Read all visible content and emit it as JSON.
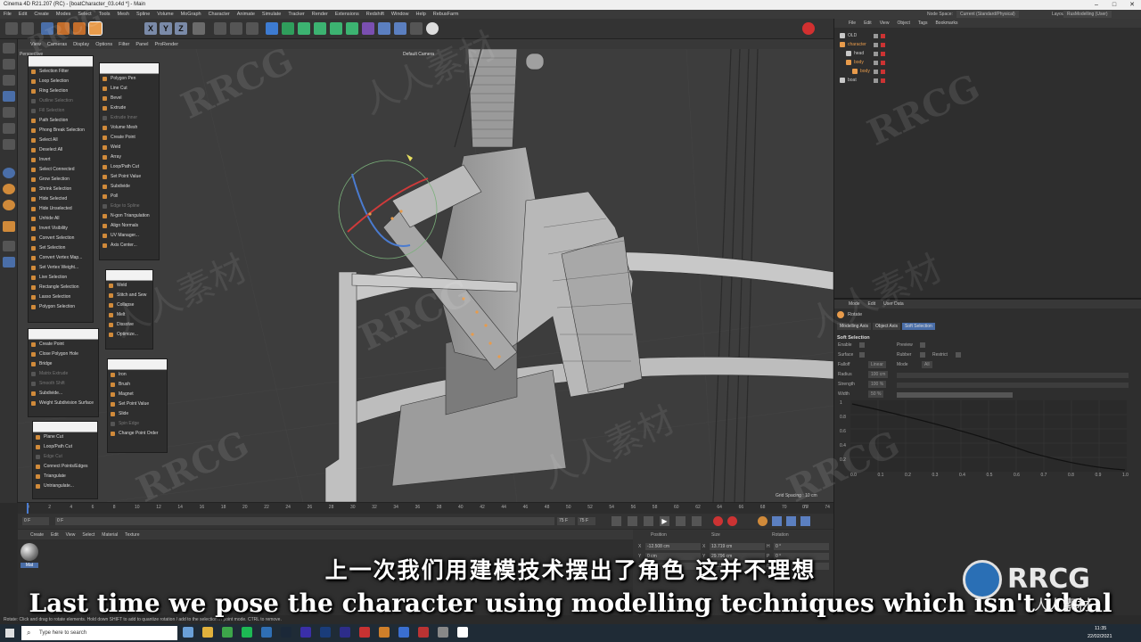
{
  "window": {
    "title": "Cinema 4D R21.207 (RC) - [boatCharacter_03.c4d *] - Main"
  },
  "menu": [
    "File",
    "Edit",
    "Create",
    "Modes",
    "Select",
    "Tools",
    "Mesh",
    "Spline",
    "Volume",
    "MoGraph",
    "Character",
    "Animate",
    "Simulate",
    "Tracker",
    "Render",
    "Extensions",
    "Redshift",
    "Window",
    "Help",
    "RebusFarm"
  ],
  "menu_right": {
    "node_space_label": "Node Space:",
    "node_space_value": "Current (Standard/Physical)",
    "layout_label": "Layout:",
    "layout_value": "RusModelling (User)"
  },
  "viewport": {
    "menu": [
      "View",
      "Cameras",
      "Display",
      "Options",
      "Filter",
      "Panel",
      "ProRender"
    ],
    "label": "Perspective",
    "camera": "Default Camera",
    "grid_spacing": "Grid Spacing : 10 cm"
  },
  "popup_select": {
    "items": [
      {
        "label": "Selection Filter",
        "dim": false
      },
      {
        "label": "Loop Selection",
        "dim": false
      },
      {
        "label": "Ring Selection",
        "dim": false
      },
      {
        "label": "Outline Selection",
        "dim": true
      },
      {
        "label": "Fill Selection",
        "dim": true
      },
      {
        "label": "Path Selection",
        "dim": false
      },
      {
        "label": "Phong Break Selection",
        "dim": false
      },
      {
        "label": "Select All",
        "dim": false
      },
      {
        "label": "Deselect All",
        "dim": false
      },
      {
        "label": "Invert",
        "dim": false
      },
      {
        "label": "Select Connected",
        "dim": false
      },
      {
        "label": "Grow Selection",
        "dim": false
      },
      {
        "label": "Shrink Selection",
        "dim": false
      },
      {
        "label": "Hide Selected",
        "dim": false
      },
      {
        "label": "Hide Unselected",
        "dim": false
      },
      {
        "label": "Unhide All",
        "dim": false
      },
      {
        "label": "Invert Visibility",
        "dim": false
      },
      {
        "label": "Convert Selection",
        "dim": false
      },
      {
        "label": "Set Selection",
        "dim": false
      },
      {
        "label": "Convert Vertex Map...",
        "dim": false
      },
      {
        "label": "Set Vertex Weight...",
        "dim": false
      },
      {
        "label": "Live Selection",
        "dim": false
      },
      {
        "label": "Rectangle Selection",
        "dim": false
      },
      {
        "label": "Lasso Selection",
        "dim": false
      },
      {
        "label": "Polygon Selection",
        "dim": false
      }
    ]
  },
  "popup_mesh": {
    "items": [
      {
        "label": "Polygon Pen",
        "dim": false
      },
      {
        "label": "Line Cut",
        "dim": false
      },
      {
        "label": "Bevel",
        "dim": false
      },
      {
        "label": "Extrude",
        "dim": false
      },
      {
        "label": "Extrude Inner",
        "dim": true
      },
      {
        "label": "Volume Mesh",
        "dim": false
      },
      {
        "label": "Create Point",
        "dim": false
      },
      {
        "label": "Weld",
        "dim": false
      },
      {
        "label": "Array",
        "dim": false
      },
      {
        "label": "Loop/Path Cut",
        "dim": false
      },
      {
        "label": "Set Point Value",
        "dim": false
      },
      {
        "label": "Subdivide",
        "dim": false
      },
      {
        "label": "Poll",
        "dim": false
      },
      {
        "label": "Edge to Spline",
        "dim": true
      },
      {
        "label": "N-gon Triangulation",
        "dim": false
      },
      {
        "label": "Align Normals",
        "dim": false
      },
      {
        "label": "UV Manager...",
        "dim": false
      },
      {
        "label": "Axis Center...",
        "dim": false
      }
    ]
  },
  "popup_points": {
    "items": [
      {
        "label": "Create Point",
        "dim": false
      },
      {
        "label": "Close Polygon Hole",
        "dim": false
      },
      {
        "label": "Bridge",
        "dim": false
      },
      {
        "label": "Matrix Extrude",
        "dim": true
      },
      {
        "label": "Smooth Shift",
        "dim": true
      },
      {
        "label": "Subdivide...",
        "dim": false
      },
      {
        "label": "Weight Subdivision Surface",
        "dim": false
      }
    ]
  },
  "popup_weld": {
    "items": [
      {
        "label": "Weld",
        "dim": false
      },
      {
        "label": "Stitch and Sew",
        "dim": false
      },
      {
        "label": "Collapse",
        "dim": false
      },
      {
        "label": "Melt",
        "dim": false
      },
      {
        "label": "Dissolve",
        "dim": false
      },
      {
        "label": "Optimize...",
        "dim": false
      }
    ]
  },
  "popup_cut": {
    "items": [
      {
        "label": "Plane Cut",
        "dim": false
      },
      {
        "label": "Loop/Path Cut",
        "dim": false
      },
      {
        "label": "Edge Cut",
        "dim": true
      },
      {
        "label": "Connect Points/Edges",
        "dim": false
      },
      {
        "label": "Triangulate",
        "dim": false
      },
      {
        "label": "Untriangulate...",
        "dim": false
      }
    ]
  },
  "popup_iron": {
    "items": [
      {
        "label": "Iron",
        "dim": false
      },
      {
        "label": "Brush",
        "dim": false
      },
      {
        "label": "Magnet",
        "dim": false
      },
      {
        "label": "Set Point Value",
        "dim": false
      },
      {
        "label": "Slide",
        "dim": false
      },
      {
        "label": "Spin Edge",
        "dim": true
      },
      {
        "label": "Change Point Order",
        "dim": false
      }
    ]
  },
  "timeline": {
    "ticks": [
      "0",
      "2",
      "4",
      "6",
      "8",
      "10",
      "12",
      "14",
      "16",
      "18",
      "20",
      "22",
      "24",
      "26",
      "28",
      "30",
      "32",
      "34",
      "36",
      "38",
      "40",
      "42",
      "44",
      "46",
      "48",
      "50",
      "52",
      "54",
      "56",
      "58",
      "60",
      "62",
      "64",
      "66",
      "68",
      "70",
      "72",
      "74"
    ],
    "start": "0 F",
    "current": "0 F",
    "end": "75 F",
    "end2": "75 F",
    "frame_end": "0 F"
  },
  "material_menu": [
    "Create",
    "Edit",
    "View",
    "Select",
    "Material",
    "Texture"
  ],
  "material_name": "Mat",
  "coords": {
    "headers": [
      "Position",
      "Size",
      "Rotation"
    ],
    "x_pos": "-12.508 cm",
    "x_size": "13.719 cm",
    "h_rot": "0 °",
    "y_pos": "0 cm",
    "y_size": "29.796 cm",
    "p_rot": "0 °",
    "z_pos": "0 cm",
    "z_size": "5.622 cm",
    "b_rot": "0 °"
  },
  "object_manager": {
    "menu": [
      "File",
      "Edit",
      "View",
      "Object",
      "Tags",
      "Bookmarks"
    ],
    "objects": [
      {
        "name": "OLD",
        "indent": 0,
        "color": "#c8c8c8"
      },
      {
        "name": "character",
        "indent": 0,
        "color": "#e89b4b"
      },
      {
        "name": "head",
        "indent": 1,
        "color": "#c8c8c8"
      },
      {
        "name": "body",
        "indent": 1,
        "color": "#e89b4b"
      },
      {
        "name": "body",
        "indent": 2,
        "color": "#e89b4b"
      },
      {
        "name": "boat",
        "indent": 0,
        "color": "#c8c8c8"
      }
    ]
  },
  "attributes": {
    "menu": [
      "Mode",
      "Edit",
      "User Data"
    ],
    "tool": "Rotate",
    "tabs": [
      "Modelling Axis",
      "Object Axis",
      "Soft Selection"
    ],
    "section": "Soft Selection",
    "fields": [
      {
        "label": "Enable",
        "value": ""
      },
      {
        "label": "Preview",
        "value": ""
      },
      {
        "label": "Surface",
        "value": ""
      },
      {
        "label": "Rubber",
        "value": ""
      },
      {
        "label": "Restrict",
        "value": ""
      },
      {
        "label": "Falloff",
        "value": "Linear"
      },
      {
        "label": "Mode",
        "value": "All"
      },
      {
        "label": "Radius",
        "value": "100 cm"
      },
      {
        "label": "Strength",
        "value": "100 %"
      },
      {
        "label": "Width",
        "value": "50 %"
      }
    ],
    "graph_y": [
      "1",
      "0.8",
      "0.6",
      "0.4",
      "0.2"
    ],
    "graph_x": [
      "0.0",
      "0.1",
      "0.2",
      "0.3",
      "0.4",
      "0.5",
      "0.6",
      "0.7",
      "0.8",
      "0.9",
      "1.0"
    ]
  },
  "status": "Rotate: Click and drag to rotate elements. Hold down SHIFT to add to quantize rotation / add to the selection in point mode. CTRL to remove.",
  "taskbar": {
    "search": "Type here to search",
    "time": "11:35",
    "date": "22/02/2021"
  },
  "subtitles": {
    "cn": "上一次我们用建模技术摆出了角色 这并不理想",
    "en": "Last time we pose the character using modelling techniques which isn't ideal"
  },
  "watermark": {
    "text": "RRCG",
    "cn": "人人素材",
    "logo_big": "RRCG",
    "logo_small": "人人素材"
  },
  "colors": {
    "accent": "#e89b4b",
    "selection": "#4a7bd0",
    "bg": "#3d3d3d"
  }
}
